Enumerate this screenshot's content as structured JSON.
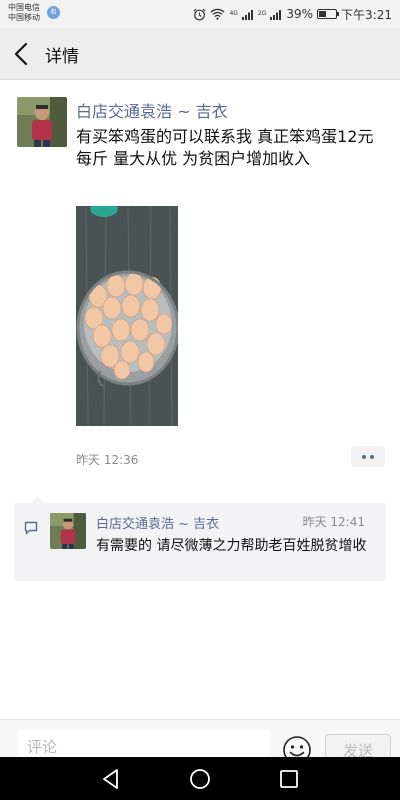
{
  "status_bar": {
    "carrier_1": "中国电信",
    "carrier_2": "中国移动",
    "carrier_badge": "和",
    "network_1": "4G",
    "network_2": "2G",
    "battery": "39%",
    "time": "下午3:21"
  },
  "header": {
    "title": "详情",
    "back_icon": "chevron-left-icon"
  },
  "post": {
    "author": "白店交通袁浩 ~ 吉衣",
    "text": "有买笨鸡蛋的可以联系我 真正笨鸡蛋12元每斤 量大从优  为贫困户增加收入",
    "time": "昨天 12:36",
    "more_icon": "more-dots-icon"
  },
  "comment": {
    "icon": "comment-icon",
    "author": "白店交通袁浩 ~ 吉衣",
    "time": "昨天 12:41",
    "text": "有需要的 请尽微薄之力帮助老百姓脱贫增收"
  },
  "input_bar": {
    "placeholder": "评论",
    "send_label": "发送",
    "emoji_icon": "emoji-icon"
  },
  "colors": {
    "link": "#576b95",
    "header_bg": "#ededed",
    "comment_bg": "#f3f3f5"
  }
}
